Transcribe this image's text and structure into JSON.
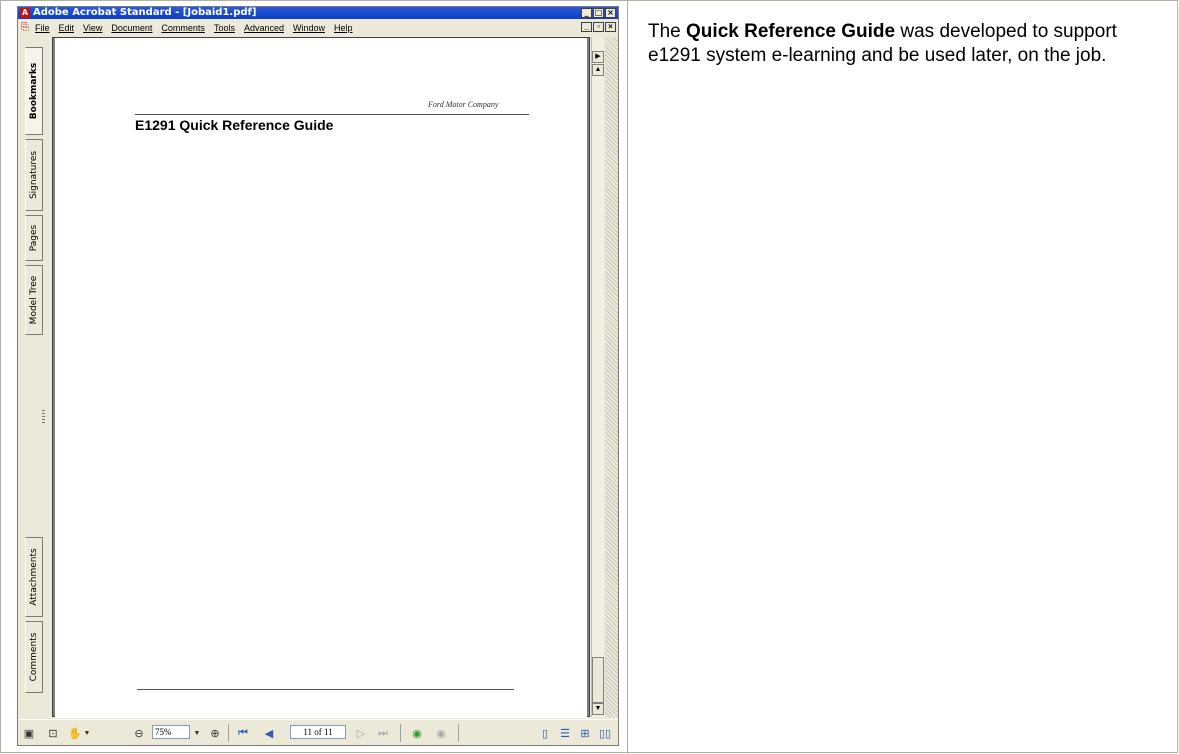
{
  "window": {
    "title": "Adobe Acrobat Standard - [Jobaid1.pdf]",
    "controls": [
      "_",
      "□",
      "×"
    ],
    "doc_controls": [
      "_",
      "▫",
      "×"
    ]
  },
  "menu": [
    "File",
    "Edit",
    "View",
    "Document",
    "Comments",
    "Tools",
    "Advanced",
    "Window",
    "Help"
  ],
  "nav_tabs": [
    "Bookmarks",
    "Signatures",
    "Pages",
    "Model Tree",
    "Attachments",
    "Comments"
  ],
  "page": {
    "logo_text": "Ford Motor Company",
    "title": "E1291 Quick Reference Guide"
  },
  "toolbar": {
    "zoom_value": "75%",
    "page_indicator": "11 of 11"
  },
  "caption": {
    "lead": "The ",
    "bold": "Quick Reference Guide",
    "rest": " was developed to support e1291 system e-learning and be used later, on the job."
  },
  "colors": {
    "titlebar": "#0a3fc8",
    "window_chrome": "#ece9d8",
    "doc_background": "#808080"
  },
  "icons": [
    "acrobat-app-icon",
    "pdf-doc-icon",
    "hand-tool-icon",
    "zoom-out-icon",
    "zoom-in-icon",
    "first-page-icon",
    "previous-page-icon",
    "next-page-icon",
    "last-page-icon",
    "go-back-icon",
    "go-forward-icon",
    "single-page-icon",
    "continuous-icon",
    "facing-icon",
    "continuous-facing-icon"
  ]
}
